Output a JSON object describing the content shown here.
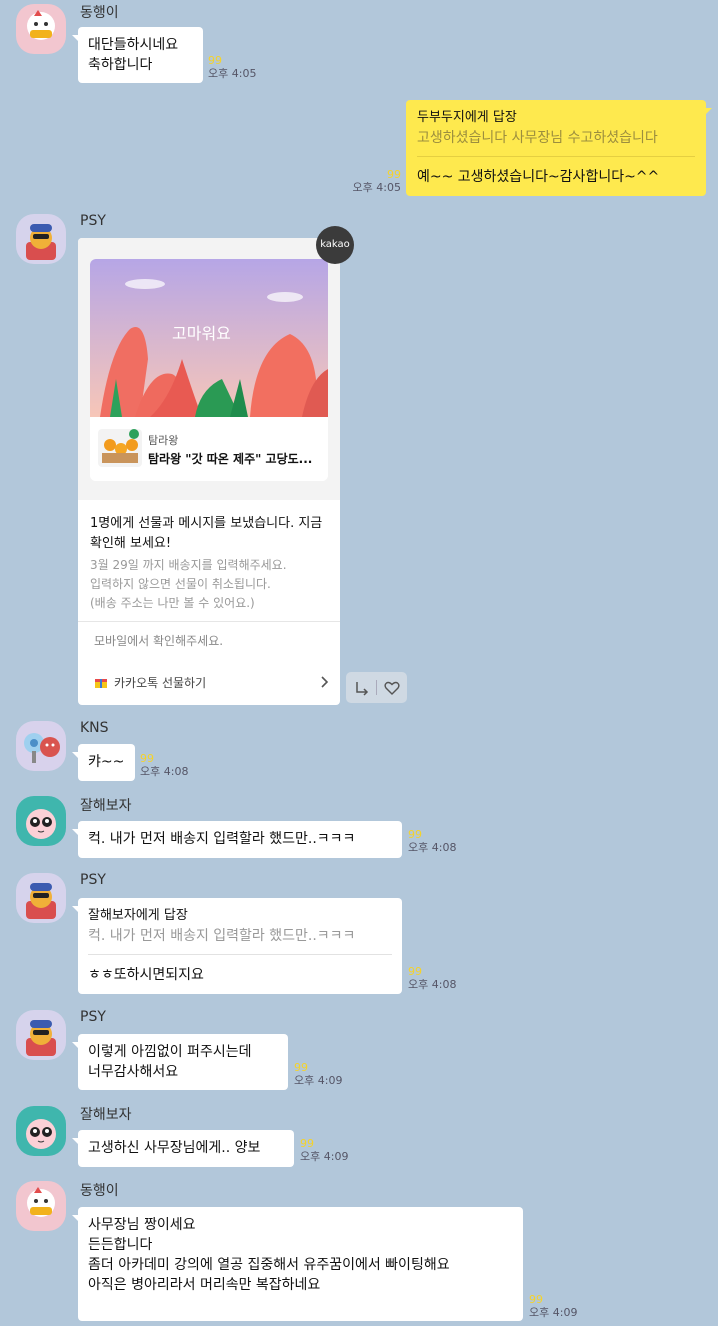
{
  "messages": {
    "m1": {
      "sender": "동행이",
      "lines": [
        "대단들하시네요",
        "축하합니다"
      ],
      "unread": "99",
      "time": "오후 4:05"
    },
    "m2": {
      "reply_to": "두부두지에게 답장",
      "quote": "고생하셨습니다 사무장님 수고하셨습니다",
      "text": "예~~ 고생하셨습니다~감사합니다~^^",
      "unread": "99",
      "time": "오후 4:05"
    },
    "m3": {
      "sender": "PSY",
      "badge": "kakao",
      "card_title": "고마워요",
      "product_brand": "탐라왕",
      "product_name": "탐라왕 \"갓 따온 제주\" 고당도...",
      "main_text": "1명에게 선물과 메시지를 보냈습니다. 지금 확인해 보세요!",
      "sub_lines": [
        "3월 29일 까지 배송지를 입력해주세요.",
        "입력하지 않으면 선물이 취소됩니다.",
        "(배송 주소는 나만 볼 수 있어요.)"
      ],
      "note": "모바일에서 확인해주세요.",
      "link_label": "카카오톡 선물하기",
      "chevron": "chevron-right-icon"
    },
    "m4": {
      "sender": "KNS",
      "text": "캬~~",
      "unread": "99",
      "time": "오후 4:08"
    },
    "m5": {
      "sender": "잘해보자",
      "text": "컥. 내가 먼저 배송지 입력할라 했드만..ㅋㅋㅋ",
      "unread": "99",
      "time": "오후 4:08"
    },
    "m6": {
      "sender": "PSY",
      "reply_to": "잘해보자에게 답장",
      "quote": "컥. 내가 먼저 배송지 입력할라 했드만..ㅋㅋㅋ",
      "text": "ㅎㅎ또하시면되지요",
      "unread": "99",
      "time": "오후 4:08"
    },
    "m7": {
      "sender": "PSY",
      "lines": [
        "이렇게 아낌없이 퍼주시는데",
        "너무감사해서요"
      ],
      "unread": "99",
      "time": "오후 4:09"
    },
    "m8": {
      "sender": "잘해보자",
      "text": "고생하신 사무장님에게.. 양보",
      "unread": "99",
      "time": "오후 4:09"
    },
    "m9": {
      "sender": "동행이",
      "lines": [
        "사무장님 짱이세요",
        "든든합니다",
        "좀더 아카데미 강의에 열공 집중해서 유주꿈이에서 빠이팅해요",
        "아직은 병아리라서 머리속만 복잡하네요"
      ],
      "unread": "99",
      "time": "오후 4:09"
    }
  },
  "colors": {
    "background": "#b2c7da",
    "my_bubble": "#fee94e",
    "other_bubble": "#ffffff",
    "unread": "#f5d32a"
  },
  "icons": [
    "share-icon",
    "heart-icon",
    "gift-box-icon",
    "chevron-right-icon"
  ]
}
